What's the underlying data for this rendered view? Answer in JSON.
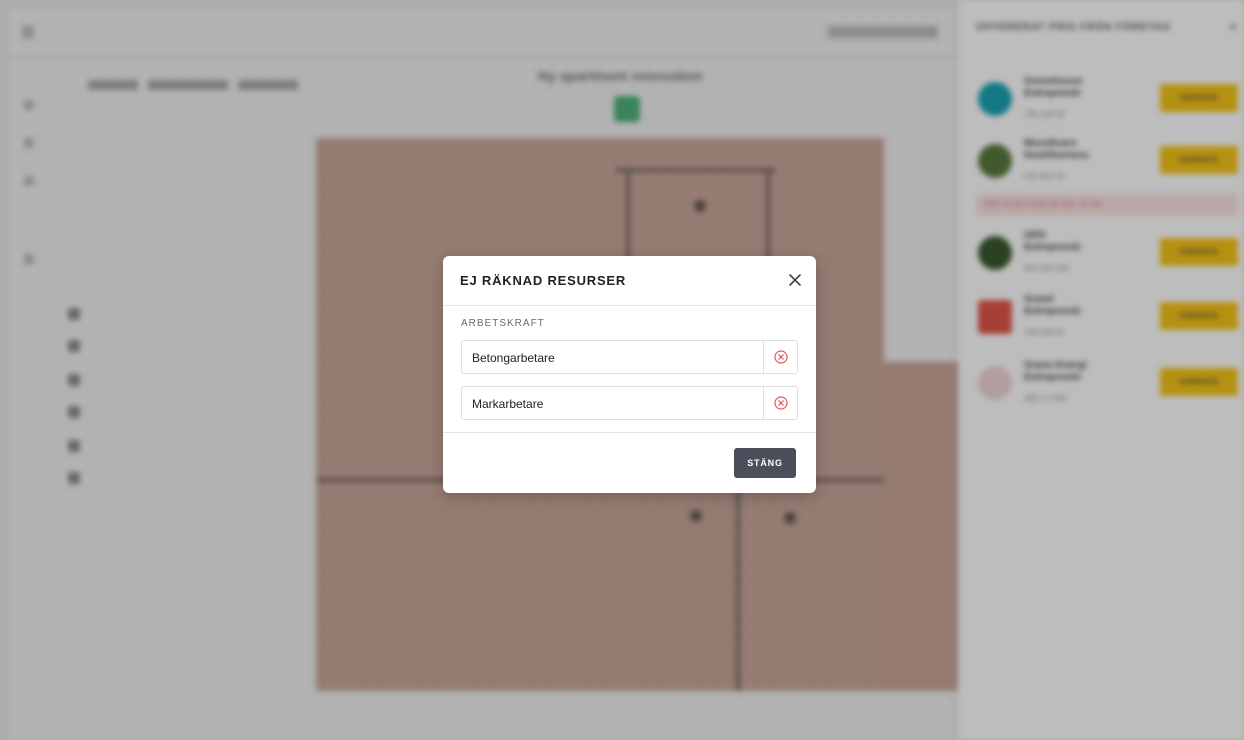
{
  "background": {
    "project_title": "Ny apartment renovation",
    "sidebar_title": "OFFERERAT PRIS FRÅN FÖRETAG",
    "companies": [
      {
        "name": "Greenhouse Entreprenör",
        "phone": "780-109 00",
        "kontakt_label": "KONTAKTA",
        "logo_color": "#19a4b4"
      },
      {
        "name": "Mossfixarn Hushfixeriera",
        "phone": "020 964 00",
        "kontakt_label": "KONTAKTA",
        "logo_color": "#5a7a3a"
      },
      {
        "name": "GRS Entreprenör",
        "phone": "063 300 180",
        "kontakt_label": "KONTAKTA",
        "logo_color": "#3b5a2e"
      },
      {
        "name": "Grand Entreprenör",
        "phone": "736 029 00",
        "kontakt_label": "KONTAKTA",
        "logo_color": "#e1574a"
      },
      {
        "name": "Grane Energi Entreprenör",
        "phone": "083 1 2 000",
        "kontakt_label": "KONTAKTA",
        "logo_color": "#f0d5d5"
      }
    ],
    "warning_text": "OBS: Du kan ha kort tid i plan. Se mer"
  },
  "modal": {
    "title": "EJ RÄKNAD RESURSER",
    "section_label": "ARBETSKRAFT",
    "resources": [
      {
        "name": "Betongarbetare"
      },
      {
        "name": "Markarbetare"
      }
    ],
    "close_button_label": "STÄNG",
    "close_icon": "close-icon",
    "remove_icon": "remove-circle-icon"
  },
  "colors": {
    "remove_icon": "#e05a5a",
    "close_button_bg": "#4b4f5c",
    "kontakt_button": "#f5c419"
  }
}
